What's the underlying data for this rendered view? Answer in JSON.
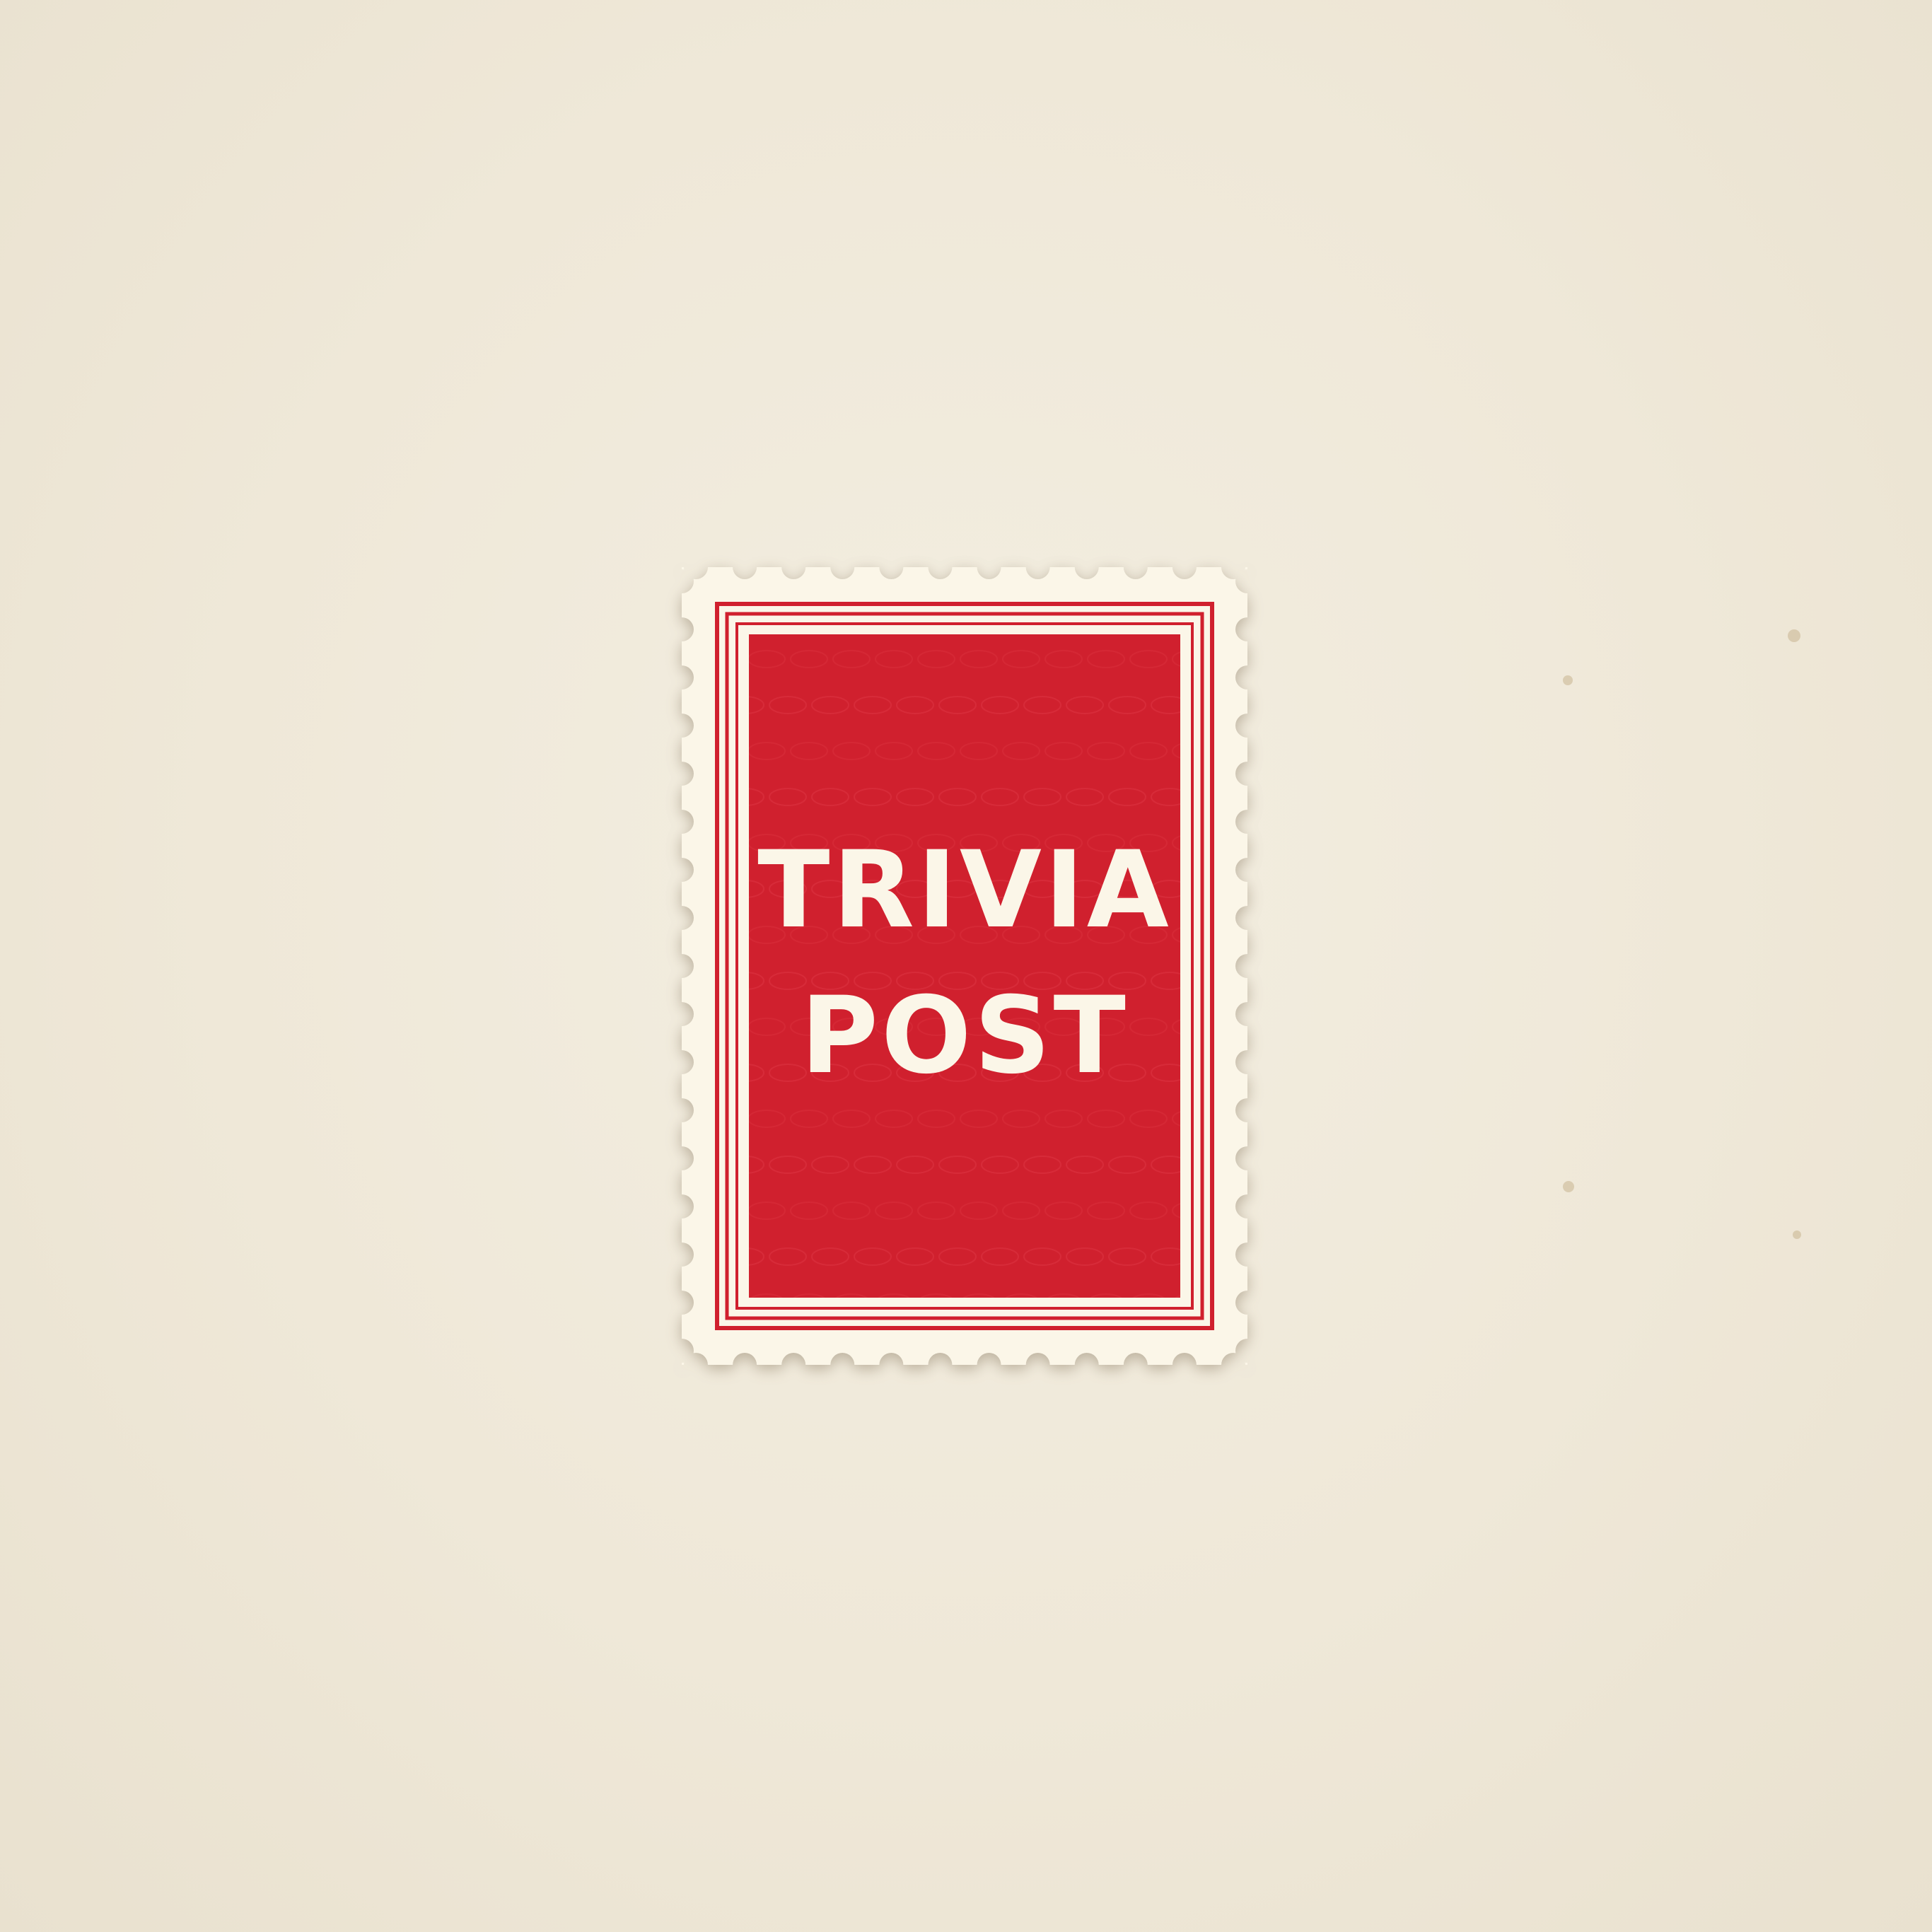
{
  "stamp": {
    "line1": "TRIVIA",
    "line2": "POST"
  },
  "colors": {
    "paper": "#efe8d8",
    "stamp_paper": "#fbf6e8",
    "stamp_red": "#d0202e"
  },
  "icons": {
    "stamp": "postage-stamp-icon"
  }
}
